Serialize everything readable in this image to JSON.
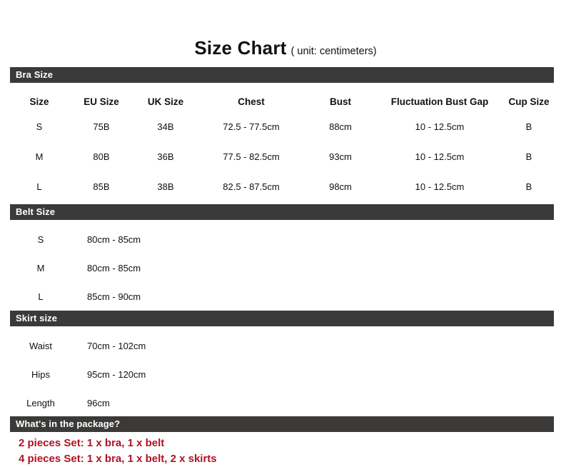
{
  "title": {
    "main": "Size Chart",
    "unit": "( unit: centimeters)"
  },
  "colors": {
    "header_bar": "#3b3a39",
    "header_text": "#ffffff",
    "body_text": "#111111",
    "package_text": "#b01223",
    "background": "#ffffff"
  },
  "sections": {
    "bra": {
      "header": "Bra Size",
      "columns": [
        "Size",
        "EU Size",
        "UK Size",
        "Chest",
        "Bust",
        "Fluctuation Bust Gap",
        "Cup Size"
      ],
      "rows": [
        [
          "S",
          "75B",
          "34B",
          "72.5 - 77.5cm",
          "88cm",
          "10 - 12.5cm",
          "B"
        ],
        [
          "M",
          "80B",
          "36B",
          "77.5 - 82.5cm",
          "93cm",
          "10 - 12.5cm",
          "B"
        ],
        [
          "L",
          "85B",
          "38B",
          "82.5 - 87.5cm",
          "98cm",
          "10 - 12.5cm",
          "B"
        ]
      ]
    },
    "belt": {
      "header": "Belt Size",
      "rows": [
        {
          "label": "S",
          "value": "80cm - 85cm"
        },
        {
          "label": "M",
          "value": "80cm - 85cm"
        },
        {
          "label": "L",
          "value": "85cm - 90cm"
        }
      ]
    },
    "skirt": {
      "header": "Skirt size",
      "rows": [
        {
          "label": "Waist",
          "value": "70cm - 102cm"
        },
        {
          "label": "Hips",
          "value": "95cm - 120cm"
        },
        {
          "label": "Length",
          "value": "96cm"
        }
      ]
    },
    "package": {
      "header": "What's in the package?",
      "lines": [
        "2 pieces Set: 1 x bra, 1 x belt",
        "4 pieces Set: 1 x bra, 1 x belt, 2 x skirts"
      ]
    }
  }
}
